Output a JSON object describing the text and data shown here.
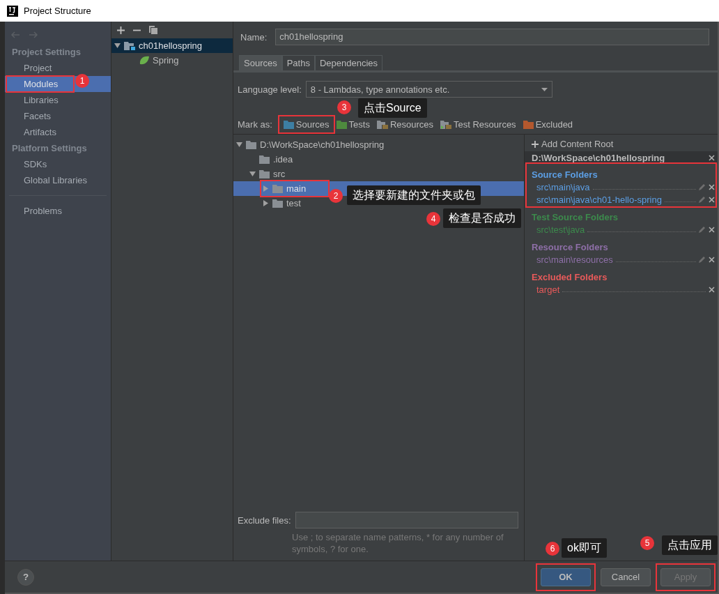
{
  "window": {
    "title": "Project Structure"
  },
  "sidebar": {
    "sections": [
      {
        "title": "Project Settings",
        "items": [
          {
            "label": "Project",
            "selected": false,
            "highlighted": false
          },
          {
            "label": "Modules",
            "selected": true,
            "highlighted": true
          },
          {
            "label": "Libraries",
            "selected": false,
            "highlighted": false
          },
          {
            "label": "Facets",
            "selected": false,
            "highlighted": false
          },
          {
            "label": "Artifacts",
            "selected": false,
            "highlighted": false
          }
        ]
      },
      {
        "title": "Platform Settings",
        "items": [
          {
            "label": "SDKs",
            "selected": false,
            "highlighted": false
          },
          {
            "label": "Global Libraries",
            "selected": false,
            "highlighted": false
          }
        ]
      }
    ],
    "bottom_items": [
      {
        "label": "Problems",
        "selected": false,
        "highlighted": false
      }
    ]
  },
  "modules": {
    "tree": [
      {
        "label": "ch01hellospring",
        "selected": true,
        "expanded": true,
        "children": [
          {
            "label": "Spring",
            "selected": false
          }
        ]
      }
    ]
  },
  "name_field": {
    "label": "Name:",
    "value": "ch01hellospring"
  },
  "tabs": [
    {
      "label": "Sources",
      "selected": true
    },
    {
      "label": "Paths",
      "selected": false
    },
    {
      "label": "Dependencies",
      "selected": false
    }
  ],
  "language_level": {
    "label": "Language level:",
    "value": "8 - Lambdas, type annotations etc."
  },
  "mark_as": {
    "label": "Mark as:",
    "buttons": [
      {
        "label": "Sources",
        "kind": "sources",
        "highlighted": true
      },
      {
        "label": "Tests",
        "kind": "tests",
        "highlighted": false
      },
      {
        "label": "Resources",
        "kind": "resources",
        "highlighted": false
      },
      {
        "label": "Test Resources",
        "kind": "test_resources",
        "highlighted": false
      },
      {
        "label": "Excluded",
        "kind": "excluded",
        "highlighted": false
      }
    ]
  },
  "file_tree": [
    {
      "label": "D:\\WorkSpace\\ch01hellospring",
      "expanded": true,
      "selected": false,
      "highlighted": false,
      "children": [
        {
          "label": ".idea",
          "selected": false,
          "highlighted": false
        },
        {
          "label": "src",
          "expanded": true,
          "selected": false,
          "highlighted": false,
          "children": [
            {
              "label": "main",
              "expanded": false,
              "selected": true,
              "highlighted": true
            },
            {
              "label": "test",
              "expanded": false,
              "selected": false,
              "highlighted": false
            }
          ]
        }
      ]
    }
  ],
  "content_root": {
    "add_label": "Add Content Root",
    "path": "D:\\WorkSpace\\ch01hellospring",
    "groups": [
      {
        "kind": "source",
        "title": "Source Folders",
        "highlighted": true,
        "entries": [
          "src\\main\\java",
          "src\\main\\java\\ch01-hello-spring"
        ]
      },
      {
        "kind": "test",
        "title": "Test Source Folders",
        "highlighted": false,
        "entries": [
          "src\\test\\java"
        ]
      },
      {
        "kind": "resource",
        "title": "Resource Folders",
        "highlighted": false,
        "entries": [
          "src\\main\\resources"
        ]
      },
      {
        "kind": "excluded",
        "title": "Excluded Folders",
        "highlighted": false,
        "entries": [
          "target"
        ]
      }
    ]
  },
  "exclude_files": {
    "label": "Exclude files:",
    "hint": "Use ; to separate name patterns, * for any number of symbols, ? for one."
  },
  "footer": {
    "help": "?",
    "buttons": [
      {
        "label": "OK",
        "kind": "default",
        "disabled": false,
        "highlighted": true
      },
      {
        "label": "Cancel",
        "kind": "normal",
        "disabled": false,
        "highlighted": false
      },
      {
        "label": "Apply",
        "kind": "normal",
        "disabled": true,
        "highlighted": true
      }
    ]
  },
  "annotations": [
    {
      "number": "1"
    },
    {
      "number": "3",
      "note": "点击Source"
    },
    {
      "number": "2",
      "note": "选择要新建的文件夹或包"
    },
    {
      "number": "4",
      "note": "检查是否成功"
    },
    {
      "number": "6",
      "note": "ok即可"
    },
    {
      "number": "5",
      "note": "点击应用"
    }
  ]
}
